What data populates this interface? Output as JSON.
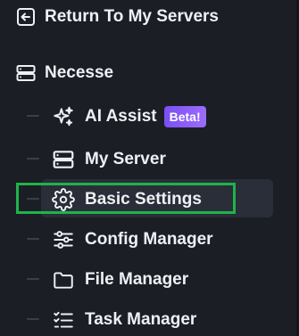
{
  "nav": {
    "back_label": "Return To My Servers",
    "server_name": "Necesse",
    "items": [
      {
        "label": "AI Assist",
        "icon": "sparkles-icon",
        "badge": "Beta!"
      },
      {
        "label": "My Server",
        "icon": "server-icon"
      },
      {
        "label": "Basic Settings",
        "icon": "gear-icon",
        "active": true
      },
      {
        "label": "Config Manager",
        "icon": "sliders-icon"
      },
      {
        "label": "File Manager",
        "icon": "folder-icon"
      },
      {
        "label": "Task Manager",
        "icon": "task-list-icon"
      }
    ]
  },
  "colors": {
    "background": "#1b1e25",
    "text": "#eef0f4",
    "active_item_bg": "#2a2e38",
    "badge": "#8a5cf8",
    "highlight_box": "#1fb34a"
  }
}
